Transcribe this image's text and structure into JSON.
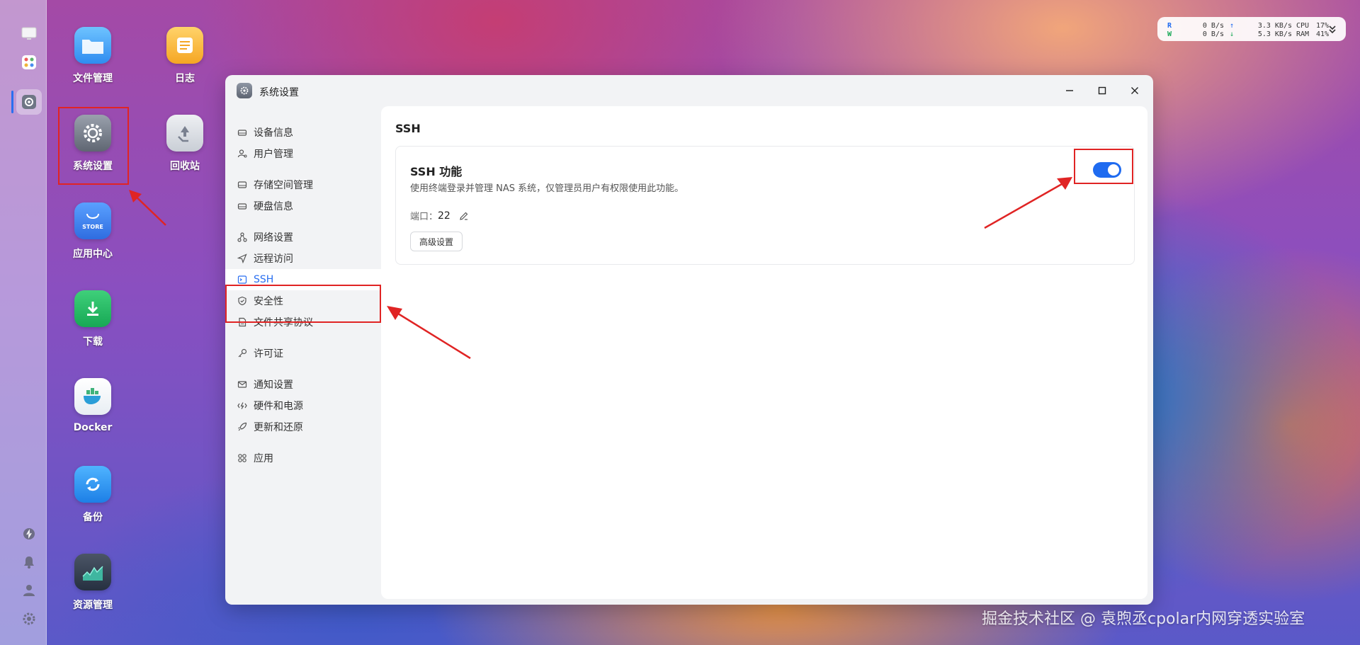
{
  "desktop_icons": [
    {
      "key": "files",
      "label": "文件管理"
    },
    {
      "key": "logs",
      "label": "日志"
    },
    {
      "key": "settings",
      "label": "系统设置"
    },
    {
      "key": "recycle",
      "label": "回收站"
    },
    {
      "key": "store",
      "label": "应用中心",
      "tile_text": "STORE"
    },
    {
      "key": "download",
      "label": "下载"
    },
    {
      "key": "docker",
      "label": "Docker"
    },
    {
      "key": "backup",
      "label": "备份"
    },
    {
      "key": "monitor",
      "label": "资源管理"
    }
  ],
  "status_widget": {
    "read_label": "R",
    "write_label": "W",
    "read_rate": "0  B/s",
    "write_rate": "0  B/s",
    "up_rate": "3.3 KB/s",
    "down_rate": "5.3 KB/s",
    "cpu_label": "CPU",
    "cpu_value": "17%",
    "ram_label": "RAM",
    "ram_value": "41%"
  },
  "window": {
    "title": "系统设置",
    "sidebar": [
      {
        "label": "设备信息",
        "icon": "drive-icon"
      },
      {
        "label": "用户管理",
        "icon": "users-icon"
      },
      {
        "label": "存储空间管理",
        "icon": "storage-icon"
      },
      {
        "label": "硬盘信息",
        "icon": "disk-icon"
      },
      {
        "label": "网络设置",
        "icon": "network-icon"
      },
      {
        "label": "远程访问",
        "icon": "send-icon"
      },
      {
        "label": "SSH",
        "icon": "terminal-icon",
        "active": true
      },
      {
        "label": "安全性",
        "icon": "shield-icon"
      },
      {
        "label": "文件共享协议",
        "icon": "file-icon"
      },
      {
        "label": "许可证",
        "icon": "key-icon"
      },
      {
        "label": "通知设置",
        "icon": "mail-icon"
      },
      {
        "label": "硬件和电源",
        "icon": "power-icon"
      },
      {
        "label": "更新和还原",
        "icon": "rocket-icon"
      },
      {
        "label": "应用",
        "icon": "apps-icon"
      }
    ],
    "content": {
      "page_title": "SSH",
      "card": {
        "title": "SSH 功能",
        "description": "使用终端登录并管理 NAS 系统，仅管理员用户有权限使用此功能。",
        "port_label": "端口：",
        "port_value": "22",
        "advanced_button": "高级设置",
        "ssh_enabled": true
      }
    }
  },
  "watermark": "掘金技术社区 @ 袁煦丞cpolar内网穿透实验室",
  "colors": {
    "accent": "#1f6bf0",
    "highlight": "#e02424"
  }
}
